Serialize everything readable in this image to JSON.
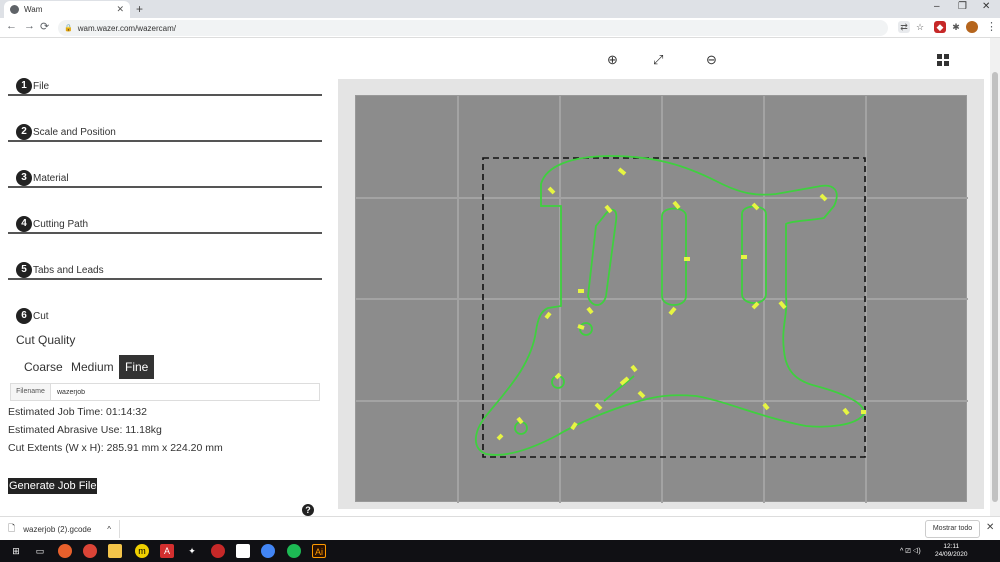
{
  "browser": {
    "tab_title": "Wam",
    "new_tab": "+",
    "url": "wam.wazer.com/wazercam/",
    "win_min": "–",
    "win_max": "❐",
    "win_close": "✕",
    "back": "←",
    "forward": "→",
    "reload": "⟳",
    "menu": "⋮"
  },
  "steps": [
    {
      "num": "1",
      "label": "File"
    },
    {
      "num": "2",
      "label": "Scale and Position"
    },
    {
      "num": "3",
      "label": "Material"
    },
    {
      "num": "4",
      "label": "Cutting Path"
    },
    {
      "num": "5",
      "label": "Tabs and Leads"
    },
    {
      "num": "6",
      "label": "Cut"
    }
  ],
  "cut": {
    "quality_label": "Cut Quality",
    "qualities": [
      "Coarse",
      "Medium",
      "Fine"
    ],
    "selected": "Fine",
    "filename_label": "Filename",
    "filename_value": "wazerjob",
    "time": "Estimated Job Time: 01:14:32",
    "abrasive": "Estimated Abrasive Use: 11.18kg",
    "extents": "Cut Extents (W x H): 285.91 mm x 224.20 mm",
    "generate": "Generate Job File",
    "help": "?"
  },
  "toolbar": {
    "zoom_in": "⊕",
    "fit": "⤢",
    "zoom_out": "⊖"
  },
  "download": {
    "file": "wazerjob (2).gcode",
    "chevron": "^",
    "show_all": "Mostrar todo",
    "close": "✕"
  },
  "taskbar": {
    "time": "12:11",
    "date": "24/09/2020",
    "lang": "^ ⎚ ◁)"
  },
  "colors": {
    "cut_path": "#3fd03f",
    "tab_marker": "#e6f542",
    "canvas_bg": "#8c8c8c"
  }
}
